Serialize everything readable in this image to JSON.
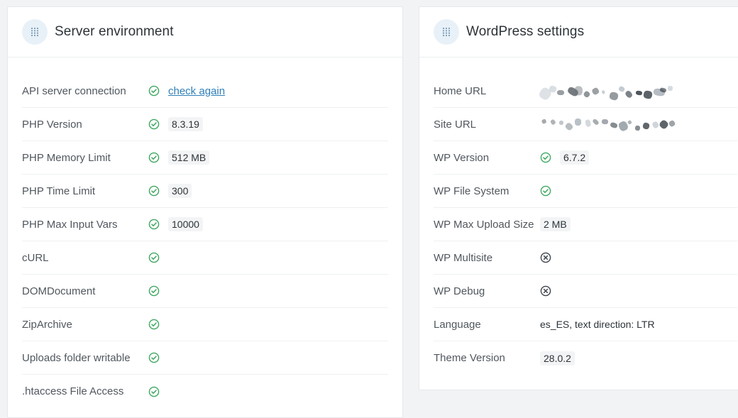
{
  "server_panel": {
    "title": "Server environment",
    "rows": [
      {
        "label": "API server connection",
        "status": "ok",
        "link": "check again"
      },
      {
        "label": "PHP Version",
        "status": "ok",
        "value": "8.3.19"
      },
      {
        "label": "PHP Memory Limit",
        "status": "ok",
        "value": "512 MB"
      },
      {
        "label": "PHP Time Limit",
        "status": "ok",
        "value": "300"
      },
      {
        "label": "PHP Max Input Vars",
        "status": "ok",
        "value": "10000"
      },
      {
        "label": "cURL",
        "status": "ok"
      },
      {
        "label": "DOMDocument",
        "status": "ok"
      },
      {
        "label": "ZipArchive",
        "status": "ok"
      },
      {
        "label": "Uploads folder writable",
        "status": "ok"
      },
      {
        "label": ".htaccess File Access",
        "status": "ok"
      }
    ]
  },
  "wp_panel": {
    "title": "WordPress settings",
    "rows": [
      {
        "label": "Home URL",
        "redacted": true
      },
      {
        "label": "Site URL",
        "redacted": true
      },
      {
        "label": "WP Version",
        "status": "ok",
        "value": "6.7.2"
      },
      {
        "label": "WP File System",
        "status": "ok"
      },
      {
        "label": "WP Max Upload Size",
        "value": "2 MB"
      },
      {
        "label": "WP Multisite",
        "status": "off"
      },
      {
        "label": "WP Debug",
        "status": "off"
      },
      {
        "label": "Language",
        "plain": "es_ES, text direction: LTR"
      },
      {
        "label": "Theme Version",
        "value": "28.0.2"
      }
    ]
  },
  "colors": {
    "ok": "#3fa760",
    "off": "#3c434a",
    "link": "#2f7fb8",
    "handle_bg": "#e8f1f8",
    "handle_dots": "#7a9bb8"
  },
  "icons": {
    "drag": "grip-dots-icon",
    "ok": "check-circle-icon",
    "off": "x-circle-icon"
  }
}
